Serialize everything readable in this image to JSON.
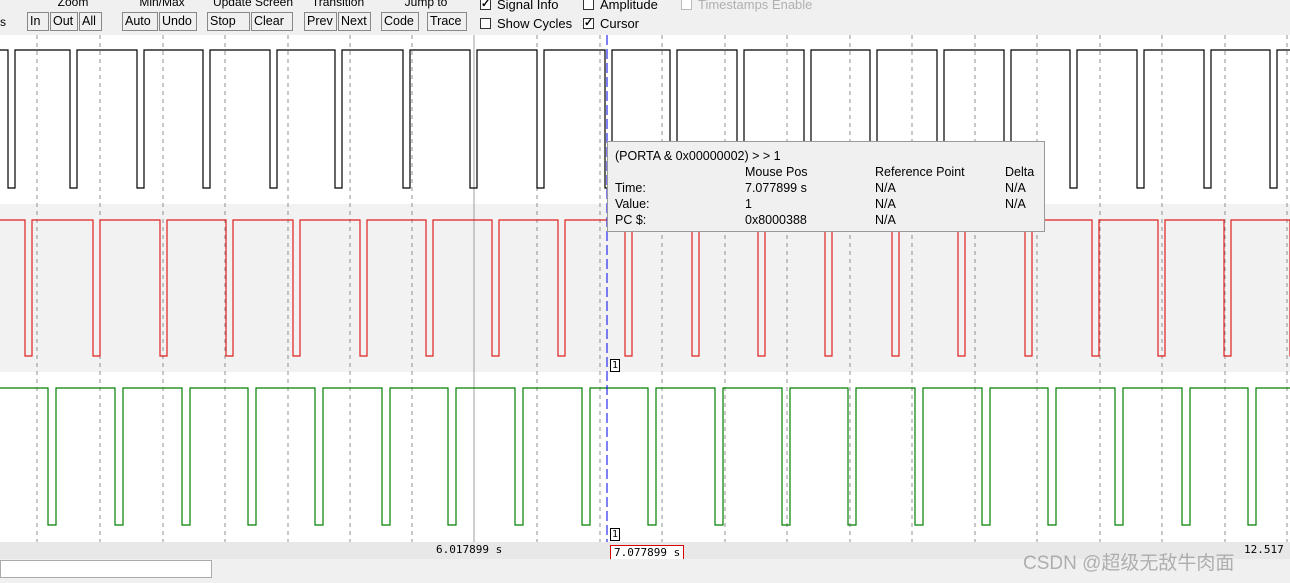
{
  "toolbar": {
    "edge_text": "s",
    "groups": [
      {
        "label": "Zoom",
        "buttons": [
          "In",
          "Out",
          "All"
        ]
      },
      {
        "label": "Min/Max",
        "buttons": [
          "Auto",
          "Undo"
        ]
      },
      {
        "label": "Update Screen",
        "buttons": [
          "Stop",
          "Clear"
        ]
      },
      {
        "label": "Transition",
        "buttons": [
          "Prev",
          "Next"
        ]
      },
      {
        "label": "Jump to",
        "buttons": [
          "Code",
          "Trace"
        ]
      }
    ],
    "options": {
      "signal_info": {
        "label": "Signal Info",
        "checked": true
      },
      "amplitude": {
        "label": "Amplitude",
        "checked": false
      },
      "timestamps": {
        "label": "Timestamps Enable",
        "checked": false,
        "enabled": false
      },
      "show_cycles": {
        "label": "Show Cycles",
        "checked": false
      },
      "cursor": {
        "label": "Cursor",
        "checked": true
      }
    }
  },
  "signals": [
    {
      "color": "#000000",
      "high_len": 2
    },
    {
      "color": "#e02020",
      "high_len": 2
    },
    {
      "color": "#008000",
      "high_len": 2
    }
  ],
  "cursor": {
    "time": "7.077899 s",
    "marker_value": "1",
    "color": "#0000ee"
  },
  "tooltip": {
    "expression": "(PORTA & 0x00000002) > > 1",
    "col_mouse_pos": "Mouse Pos",
    "col_reference": "Reference Point",
    "col_delta": "Delta",
    "rows": [
      {
        "label": "Time:",
        "mouse": "7.077899 s",
        "ref": "N/A",
        "delta": "N/A"
      },
      {
        "label": "Value:",
        "mouse": "1",
        "ref": "N/A",
        "delta": "N/A"
      },
      {
        "label": "PC $:",
        "mouse": "0x8000388",
        "ref": "N/A",
        "delta": ""
      }
    ]
  },
  "timeline": {
    "mid_label": "6.017899 s",
    "cursor_label": "7.077899 s",
    "right_label": "12.517"
  },
  "watermark": "CSDN @超级无敌牛肉面"
}
